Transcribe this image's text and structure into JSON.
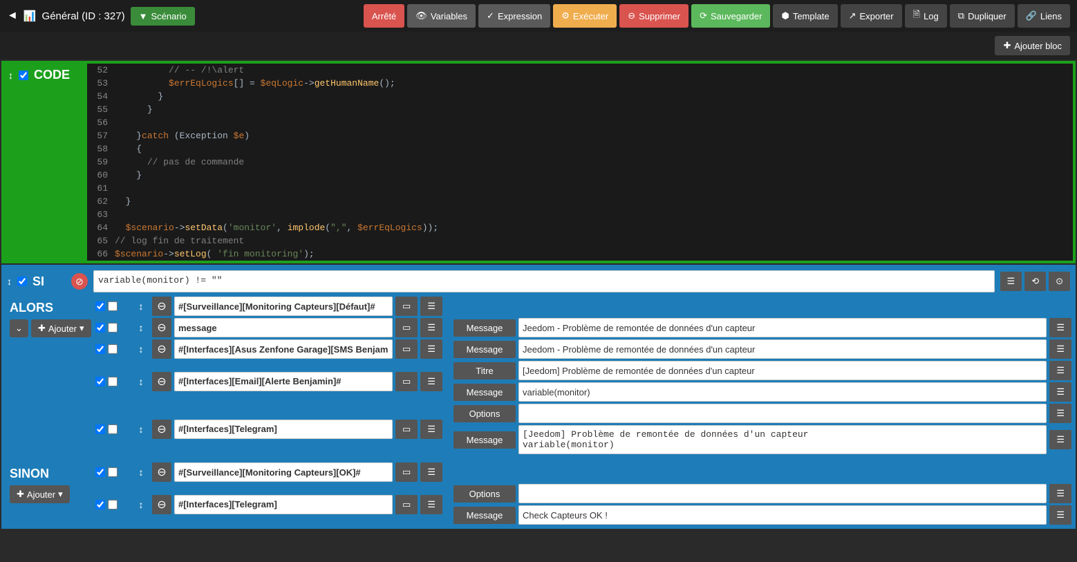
{
  "nav": {
    "title": "Général (ID : 327)",
    "scenario_btn": "Scénario",
    "arrete": "Arrêté",
    "variables": "Variables",
    "expression": "Expression",
    "executer": "Exécuter",
    "supprimer": "Supprimer",
    "sauvegarder": "Sauvegarder",
    "template": "Template",
    "exporter": "Exporter",
    "log": "Log",
    "dupliquer": "Dupliquer",
    "liens": "Liens",
    "ajouter_bloc": "Ajouter bloc"
  },
  "code": {
    "label": "CODE",
    "lines": [
      {
        "n": "52",
        "indent": "          ",
        "html": "<span class='com'>// -- /!\\alert</span>"
      },
      {
        "n": "53",
        "indent": "          ",
        "html": "<span class='var'>$errEqLogics</span><span class='txt'>[] = </span><span class='var'>$eqLogic</span><span class='txt'>-></span><span class='fn'>getHumanName</span><span class='txt'>();</span>"
      },
      {
        "n": "54",
        "indent": "        ",
        "html": "<span class='txt'>}</span>"
      },
      {
        "n": "55",
        "indent": "      ",
        "html": "<span class='txt'>}</span>"
      },
      {
        "n": "56",
        "indent": "",
        "html": ""
      },
      {
        "n": "57",
        "indent": "    ",
        "html": "<span class='txt'>}</span><span class='kw'>catch</span><span class='txt'> (Exception </span><span class='var'>$e</span><span class='txt'>)</span>"
      },
      {
        "n": "58",
        "indent": "    ",
        "html": "<span class='txt'>{</span>"
      },
      {
        "n": "59",
        "indent": "      ",
        "html": "<span class='com'>// pas de commande</span>"
      },
      {
        "n": "60",
        "indent": "    ",
        "html": "<span class='txt'>}</span>"
      },
      {
        "n": "61",
        "indent": "",
        "html": ""
      },
      {
        "n": "62",
        "indent": "  ",
        "html": "<span class='txt'>}</span>"
      },
      {
        "n": "63",
        "indent": "",
        "html": ""
      },
      {
        "n": "64",
        "indent": "  ",
        "html": "<span class='var'>$scenario</span><span class='txt'>-></span><span class='fn'>setData</span><span class='txt'>(</span><span class='str'>'monitor'</span><span class='txt'>, </span><span class='fn'>implode</span><span class='txt'>(</span><span class='str'>\",\"</span><span class='txt'>, </span><span class='var'>$errEqLogics</span><span class='txt'>));</span>"
      },
      {
        "n": "65",
        "indent": "",
        "html": "<span class='com'>// log fin de traitement</span>"
      },
      {
        "n": "66",
        "indent": "",
        "html": "<span class='var'>$scenario</span><span class='txt'>-></span><span class='fn'>setLog</span><span class='txt'>( </span><span class='str'>'fin monitoring'</span><span class='txt'>);</span>"
      }
    ]
  },
  "si": {
    "label": "SI",
    "condition": "variable(monitor) != \"\""
  },
  "alors": {
    "label": "ALORS",
    "ajouter": "Ajouter",
    "actions": [
      {
        "cmd": "#[Surveillance][Monitoring Capteurs][Défaut]#",
        "params": []
      },
      {
        "cmd": "message",
        "params": [
          {
            "label": "Message",
            "value": "Jeedom - Problème de remontée de données d'un capteur"
          }
        ]
      },
      {
        "cmd": "#[Interfaces][Asus Zenfone Garage][SMS Benjamin]#",
        "params": [
          {
            "label": "Message",
            "value": "Jeedom - Problème de remontée de données d'un capteur"
          }
        ]
      },
      {
        "cmd": "#[Interfaces][Email][Alerte Benjamin]#",
        "params": [
          {
            "label": "Titre",
            "value": "[Jeedom] Problème de remontée de données d'un capteur"
          },
          {
            "label": "Message",
            "value": "variable(monitor)"
          }
        ]
      },
      {
        "cmd": "#[Interfaces][Telegram]",
        "params": [
          {
            "label": "Options",
            "value": ""
          },
          {
            "label": "Message",
            "value": "[Jeedom] Problème de remontée de données d'un capteur\nvariable(monitor)",
            "textarea": true
          }
        ]
      }
    ]
  },
  "sinon": {
    "label": "SINON",
    "ajouter": "Ajouter",
    "actions": [
      {
        "cmd": "#[Surveillance][Monitoring Capteurs][OK]#",
        "params": []
      },
      {
        "cmd": "#[Interfaces][Telegram]",
        "params": [
          {
            "label": "Options",
            "value": ""
          },
          {
            "label": "Message",
            "value": "Check Capteurs OK !"
          }
        ]
      }
    ]
  }
}
